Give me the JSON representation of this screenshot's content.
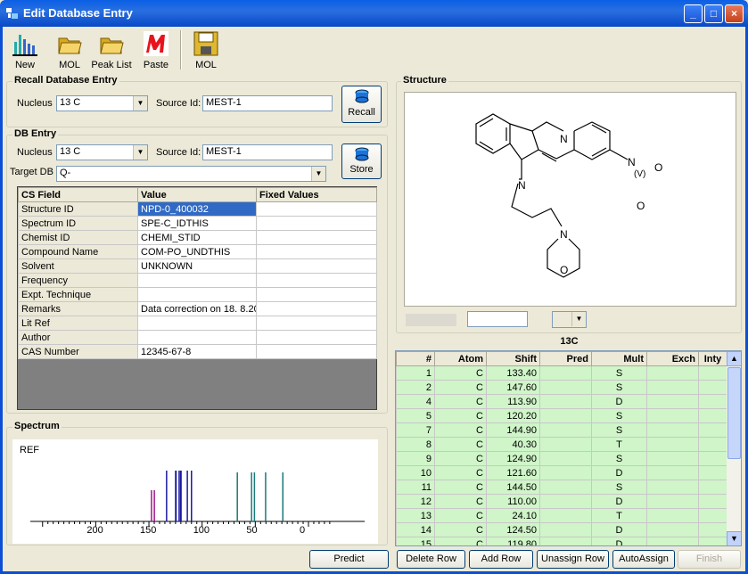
{
  "window": {
    "title": "Edit Database Entry",
    "minimize": "_",
    "maximize": "□",
    "close": "×"
  },
  "toolbar": [
    {
      "label": "New",
      "icon": "bar-chart-icon"
    },
    {
      "label": "MOL",
      "icon": "folder-open-icon"
    },
    {
      "label": "Peak List",
      "icon": "folder-open-icon"
    },
    {
      "label": "Paste",
      "icon": "paste-logo-icon"
    },
    {
      "label": "MOL",
      "icon": "floppy-disk-icon"
    }
  ],
  "recall": {
    "legend": "Recall Database Entry",
    "nucleus_label": "Nucleus",
    "nucleus_value": "13 C",
    "source_label": "Source Id:",
    "source_value": "MEST-1",
    "button": "Recall"
  },
  "db": {
    "legend": "DB Entry",
    "nucleus_label": "Nucleus",
    "nucleus_value": "13 C",
    "source_label": "Source Id:",
    "source_value": "MEST-1",
    "target_label": "Target DB",
    "target_value": "Q-",
    "button": "Store",
    "columns": [
      "CS Field",
      "Value",
      "Fixed Values"
    ],
    "rows": [
      [
        "Structure ID",
        "NPD-0_400032",
        ""
      ],
      [
        "Spectrum ID",
        "SPE-C_IDTHIS",
        ""
      ],
      [
        "Chemist ID",
        "CHEMI_STID",
        ""
      ],
      [
        "Compound Name",
        "COM-PO_UNDTHIS",
        ""
      ],
      [
        "Solvent",
        "UNKNOWN",
        ""
      ],
      [
        "Frequency",
        "",
        ""
      ],
      [
        "Expt. Technique",
        "",
        ""
      ],
      [
        "Remarks",
        "Data correction on 18. 8.20",
        ""
      ],
      [
        "Lit Ref",
        "",
        ""
      ],
      [
        "Author",
        "",
        ""
      ],
      [
        "CAS Number",
        "12345-67-8",
        ""
      ]
    ]
  },
  "spectrum": {
    "legend": "Spectrum",
    "ref_label": "REF",
    "axis_labels": [
      "200",
      "150",
      "100",
      "50",
      "0"
    ],
    "peaks_ppm": [
      144.9,
      147.6,
      133.4,
      124.9,
      124.5,
      121.6,
      120.2,
      119.8,
      113.9,
      110.0,
      66.9,
      53.5,
      50.8,
      40.3,
      24.1
    ]
  },
  "structure": {
    "legend": "Structure",
    "atoms": {
      "N1": "N",
      "N2": "N",
      "N3": "N",
      "O": "O",
      "N4": "N",
      "O1": "O",
      "O2": "O",
      "charge": "(V)"
    }
  },
  "assign": {
    "title": "13C",
    "columns": [
      "#",
      "Atom",
      "Shift",
      "Pred",
      "Mult",
      "Exch",
      "Inty"
    ],
    "rows": [
      [
        "1",
        "C",
        "133.40",
        "",
        "S",
        "",
        ""
      ],
      [
        "2",
        "C",
        "147.60",
        "",
        "S",
        "",
        ""
      ],
      [
        "4",
        "C",
        "113.90",
        "",
        "D",
        "",
        ""
      ],
      [
        "5",
        "C",
        "120.20",
        "",
        "S",
        "",
        ""
      ],
      [
        "7",
        "C",
        "144.90",
        "",
        "S",
        "",
        ""
      ],
      [
        "8",
        "C",
        "40.30",
        "",
        "T",
        "",
        ""
      ],
      [
        "9",
        "C",
        "124.90",
        "",
        "S",
        "",
        ""
      ],
      [
        "10",
        "C",
        "121.60",
        "",
        "D",
        "",
        ""
      ],
      [
        "11",
        "C",
        "144.50",
        "",
        "S",
        "",
        ""
      ],
      [
        "12",
        "C",
        "110.00",
        "",
        "D",
        "",
        ""
      ],
      [
        "13",
        "C",
        "24.10",
        "",
        "T",
        "",
        ""
      ],
      [
        "14",
        "C",
        "124.50",
        "",
        "D",
        "",
        ""
      ],
      [
        "15",
        "C",
        "119.80",
        "",
        "D",
        "",
        ""
      ]
    ]
  },
  "bottom_buttons": {
    "predict": "Predict",
    "delete": "Delete Row",
    "add": "Add Row",
    "unassign": "Unassign Row",
    "autoassign": "AutoAssign",
    "finish": "Finish"
  },
  "colors": {
    "title_bar": "#0a5fe6",
    "selection": "#316ac5",
    "assign_row": "#cff5c8",
    "peak_magenta": "#a0168c",
    "peak_blue": "#1a1aa0",
    "peak_teal": "#1a7a7a"
  }
}
